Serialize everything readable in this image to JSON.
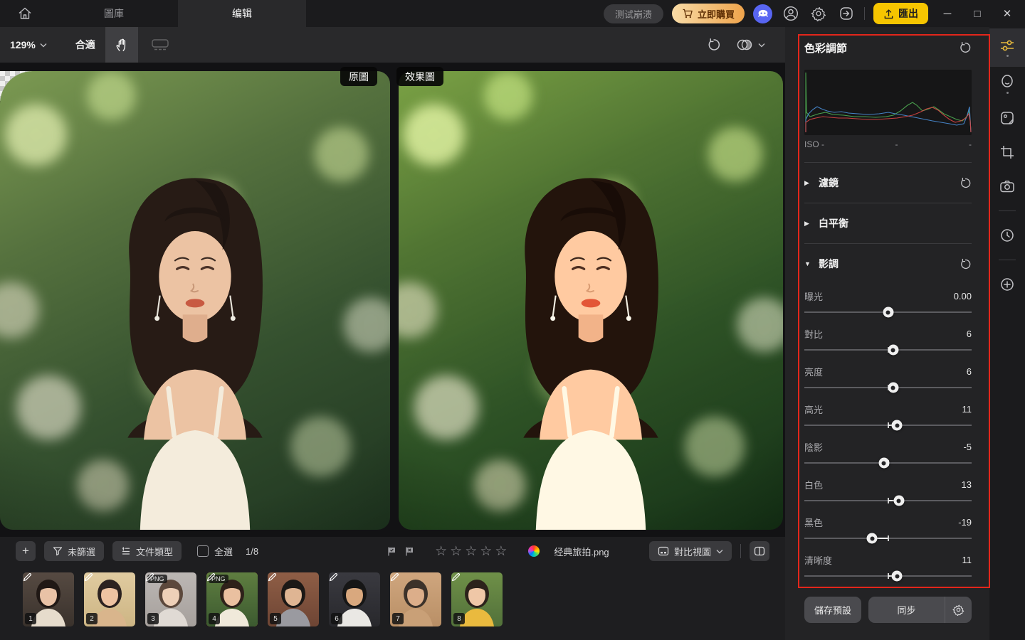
{
  "titlebar": {
    "tab_gallery": "圖庫",
    "tab_edit": "编辑",
    "test_crash": "测试崩溃",
    "buy_now": "立即購買",
    "export_label": "匯出",
    "discord_color": "#5865F2",
    "export_color": "#F6C500",
    "buy_gradient": [
      "#F8DBA6",
      "#EFA44C"
    ]
  },
  "toolbar": {
    "zoom_level": "129%",
    "fit_label": "合適"
  },
  "canvas": {
    "original_label": "原圖",
    "effect_label": "效果圖"
  },
  "panel": {
    "title": "色彩調節",
    "iso_items": [
      "ISO -",
      "-",
      "-"
    ],
    "section_filter": "濾鏡",
    "section_white_balance": "白平衡",
    "section_tone": "影調",
    "sliders": [
      {
        "label": "曝光",
        "display": "0.00",
        "value": 0
      },
      {
        "label": "對比",
        "display": "6",
        "value": 6
      },
      {
        "label": "亮度",
        "display": "6",
        "value": 6
      },
      {
        "label": "高光",
        "display": "11",
        "value": 11
      },
      {
        "label": "陰影",
        "display": "-5",
        "value": -5
      },
      {
        "label": "白色",
        "display": "13",
        "value": 13
      },
      {
        "label": "黑色",
        "display": "-19",
        "value": -19
      },
      {
        "label": "清晰度",
        "display": "11",
        "value": 11
      }
    ],
    "save_preset": "儲存預設",
    "sync": "同步",
    "annotation_color": "#E3261B"
  },
  "filmstrip": {
    "filter_label": "未篩選",
    "file_type_label": "文件類型",
    "select_all_label": "全選",
    "counter": "1/8",
    "stars": 5,
    "filename": "经典旅拍.png",
    "compare_view_label": "對比視圖",
    "thumbnails": [
      {
        "num": "1",
        "badge": "",
        "selected": false,
        "palette": {
          "bg1": "#564a42",
          "bg2": "#3a322c",
          "hair": "#201815",
          "skin": "#e9c2a6",
          "top": "#e6dccc"
        }
      },
      {
        "num": "2",
        "badge": "",
        "selected": false,
        "palette": {
          "bg1": "#e0cba0",
          "bg2": "#cdb584",
          "hair": "#2c2220",
          "skin": "#eec3a2",
          "top": "#d9b58c"
        }
      },
      {
        "num": "3",
        "badge": "PNG",
        "selected": false,
        "palette": {
          "bg1": "#bcb7b4",
          "bg2": "#a6a09c",
          "hair": "#5c483c",
          "skin": "#eed0b8",
          "top": "#e0dad4"
        }
      },
      {
        "num": "4",
        "badge": "PNG",
        "selected": true,
        "palette": {
          "bg1": "#5f7e40",
          "bg2": "#3c5a30",
          "hair": "#2e211a",
          "skin": "#eac0a0",
          "top": "#f0e9da"
        }
      },
      {
        "num": "5",
        "badge": "",
        "selected": false,
        "palette": {
          "bg1": "#8f5e46",
          "bg2": "#6e4534",
          "hair": "#1c1816",
          "skin": "#dfb593",
          "top": "#9a9aa0"
        }
      },
      {
        "num": "6",
        "badge": "",
        "selected": false,
        "palette": {
          "bg1": "#3a3a40",
          "bg2": "#28282c",
          "hair": "#161616",
          "skin": "#d9a87e",
          "top": "#eae8e4"
        }
      },
      {
        "num": "7",
        "badge": "",
        "selected": false,
        "palette": {
          "bg1": "#cfa67e",
          "bg2": "#b98f66",
          "hair": "#3c322a",
          "skin": "#dcae8a",
          "top": "#c9a077"
        }
      },
      {
        "num": "8",
        "badge": "",
        "selected": false,
        "palette": {
          "bg1": "#6f9048",
          "bg2": "#52713a",
          "hair": "#2c221b",
          "skin": "#efc7a7",
          "top": "#eaba3e"
        }
      }
    ]
  },
  "sidebar": {
    "icons": [
      "adjust-sliders",
      "face-retouch",
      "portrait-image",
      "crop",
      "camera",
      "history",
      "add"
    ]
  }
}
